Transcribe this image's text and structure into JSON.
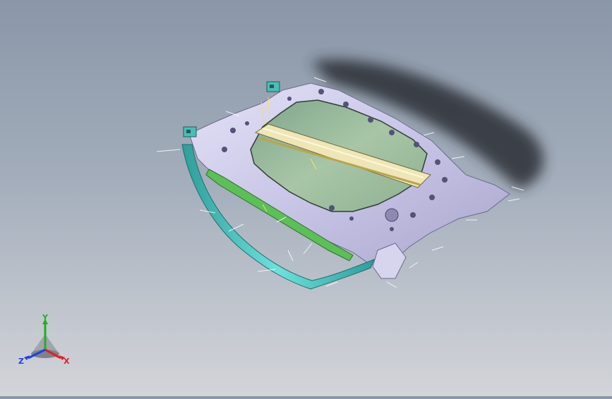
{
  "viewport": {
    "background_top": "#8a97a8",
    "background_bottom": "#d2d4d8"
  },
  "model": {
    "panel_color": "#c8c6e8",
    "glass_color": "#a9c3a4",
    "seal_color": "#4fc7c2",
    "frame_color": "#3aa39c",
    "shadow_color": "#2c2f34"
  },
  "triad": {
    "x_label": "X",
    "y_label": "Y",
    "z_label": "Z",
    "x_color": "#e02020",
    "y_color": "#20b020",
    "z_color": "#2040e0"
  }
}
